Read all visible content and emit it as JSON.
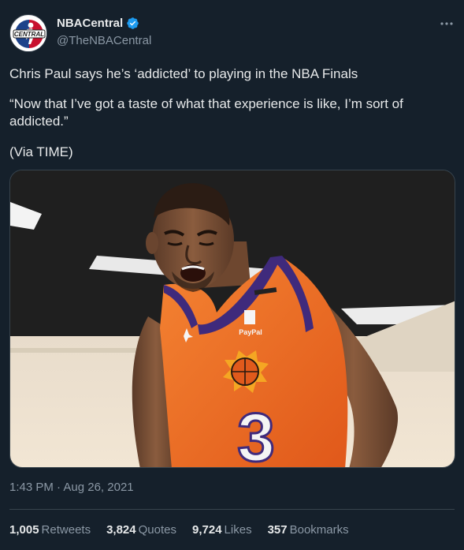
{
  "account": {
    "display_name": "NBACentral",
    "handle": "@TheNBACentral",
    "verified": true,
    "avatar_icon": "nba-central-logo",
    "avatar_text": "CENTRAL"
  },
  "tweet": {
    "line1": "Chris Paul says he’s ‘addicted’ to playing in the NBA Finals",
    "line2": "“Now that I’ve got a taste of what that experience is like, I’m sort of addicted.”",
    "line3": "(Via TIME)"
  },
  "media": {
    "jersey_number": "3",
    "sponsor": "PayPal"
  },
  "timestamp": {
    "time": "1:43 PM",
    "separator": " · ",
    "date": "Aug 26, 2021"
  },
  "stats": [
    {
      "value": "1,005",
      "label": "Retweets"
    },
    {
      "value": "3,824",
      "label": "Quotes"
    },
    {
      "value": "9,724",
      "label": "Likes"
    },
    {
      "value": "357",
      "label": "Bookmarks"
    }
  ],
  "colors": {
    "background": "#15202b",
    "verified_blue": "#1d9bf0",
    "secondary_text": "#8b98a5",
    "jersey_orange": "#f26b1d",
    "jersey_purple": "#3f2a7c"
  }
}
